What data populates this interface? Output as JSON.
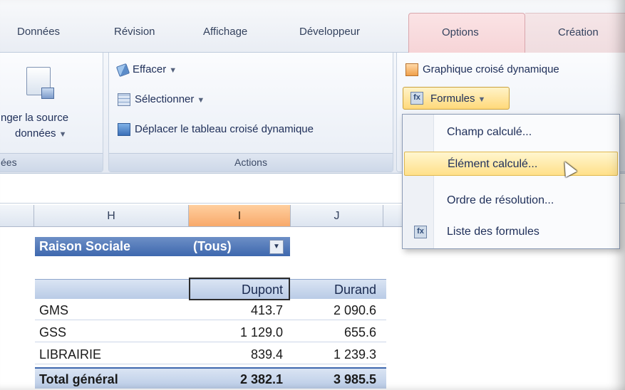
{
  "ribbon": {
    "tabs": [
      "Données",
      "Révision",
      "Affichage",
      "Développeur",
      "Options",
      "Création"
    ],
    "data_group": {
      "change_source_line1": "nger la source",
      "change_source_line2": "données",
      "label": "ées"
    },
    "actions_group": {
      "clear": "Effacer",
      "select": "Sélectionner",
      "move": "Déplacer le tableau croisé dynamique",
      "label": "Actions"
    },
    "tools_group": {
      "pivot_chart": "Graphique croisé dynamique",
      "formulas": "Formules"
    }
  },
  "formulas_menu": {
    "items": [
      "Champ calculé...",
      "Élément calculé...",
      "Ordre de résolution...",
      "Liste des formules"
    ],
    "highlighted_index": 1
  },
  "sheet": {
    "columns": [
      "H",
      "I",
      "J"
    ],
    "selected_column": "I"
  },
  "pivot": {
    "filter_field": "Raison Sociale",
    "filter_value": "(Tous)",
    "column_headers": [
      "Dupont",
      "Durand"
    ],
    "rows": [
      {
        "label": "GMS",
        "values": [
          "413.7",
          "2 090.6"
        ]
      },
      {
        "label": "GSS",
        "values": [
          "1 129.0",
          "655.6"
        ]
      },
      {
        "label": "LIBRAIRIE",
        "values": [
          "839.4",
          "1 239.3"
        ]
      }
    ],
    "total": {
      "label": "Total général",
      "values": [
        "2 382.1",
        "3 985.5"
      ]
    }
  },
  "colors": {
    "accent_tab": "#f6d4d7",
    "pivot_header": "#3e68ae",
    "menu_highlight": "#ffe08a",
    "selected_column": "#f8a96a"
  }
}
